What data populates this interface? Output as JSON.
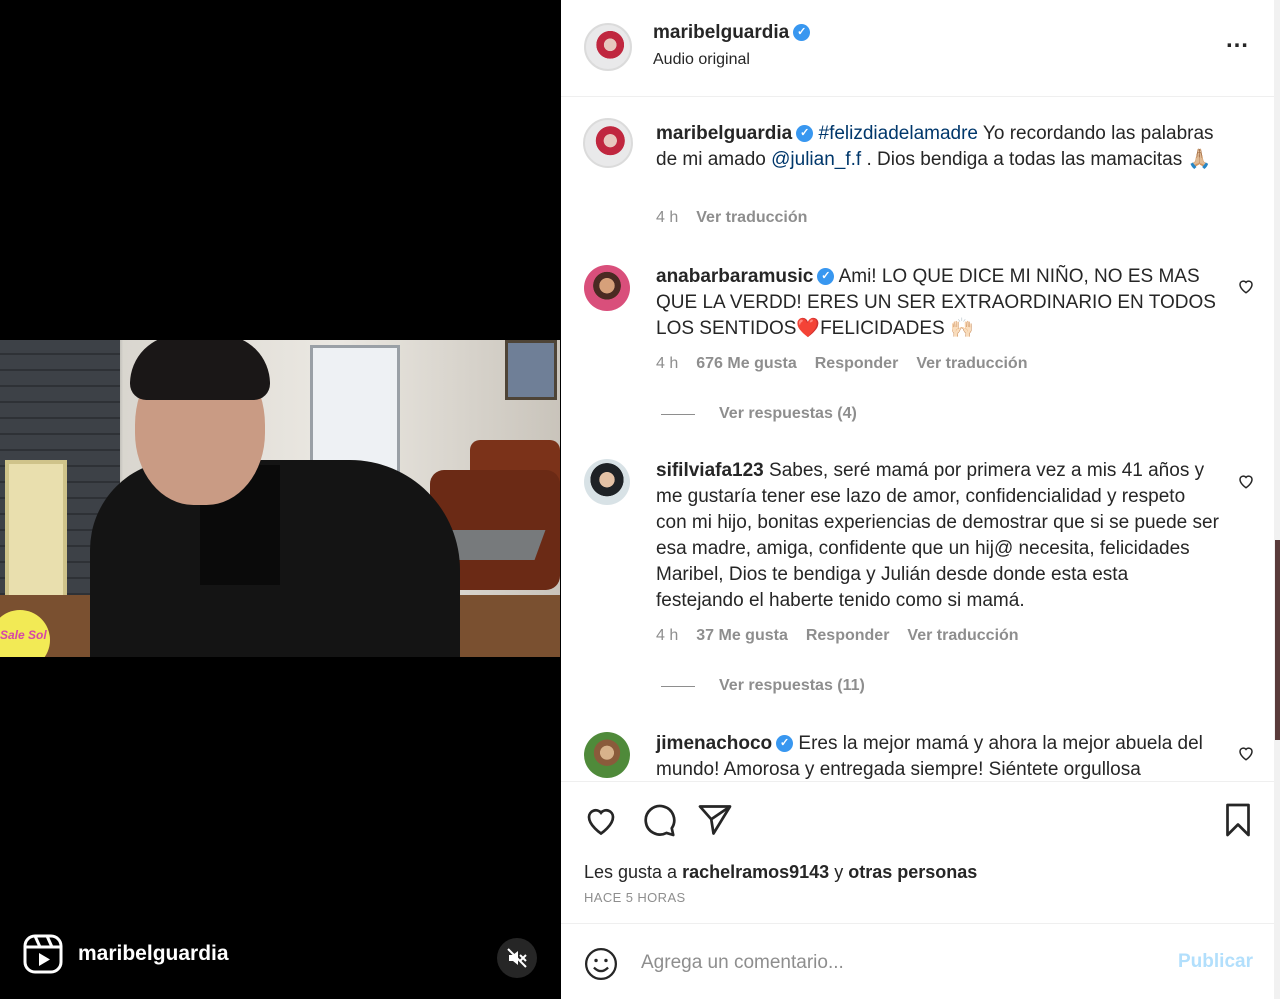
{
  "video": {
    "username": "maribelguardia",
    "badge_text": "Sale Sol",
    "reels_icon": "reels-icon",
    "mute_icon": "speaker-muted-icon"
  },
  "header": {
    "username": "maribelguardia",
    "verified_icon": "verified-badge-icon",
    "audio": "Audio original",
    "more_icon": "more-options-icon"
  },
  "caption": {
    "username": "maribelguardia",
    "hashtag": "#felizdiadelamadre",
    "text_1": " Yo recordando las palabras de mi amado ",
    "mention": "@julian_f.f",
    "text_2": " . Dios bendiga a todas las mamacitas 🙏🏼",
    "time": "4 h",
    "translate": "Ver traducción"
  },
  "comments": [
    {
      "username": "anabarbaramusic",
      "verified": true,
      "text": " Ami! LO QUE DICE MI NIÑO, NO ES MAS QUE LA VERDD! ERES UN SER EXTRAORDINARIO EN TODOS LOS SENTIDOS❤️FELICIDADES 🙌🏻",
      "time": "4 h",
      "likes": "676 Me gusta",
      "reply": "Responder",
      "translate": "Ver traducción",
      "replies": "Ver respuestas (4)"
    },
    {
      "username": "sifilviafa123",
      "verified": false,
      "text": " Sabes, seré mamá por primera vez a mis 41 años y me gustaría tener ese lazo de amor, confidencialidad y respeto con mi hijo, bonitas experiencias de demostrar que si se puede ser esa madre, amiga, confidente que un hij@ necesita, felicidades Maribel, Dios te bendiga y Julián desde donde esta esta festejando el haberte tenido como si mamá.",
      "time": "4 h",
      "likes": "37 Me gusta",
      "reply": "Responder",
      "translate": "Ver traducción",
      "replies": "Ver respuestas (11)"
    },
    {
      "username": "jimenachoco",
      "verified": true,
      "text": " Eres la mejor mamá y ahora la mejor abuela del mundo! Amorosa y entregada siempre! Siéntete orgullosa"
    }
  ],
  "actions": {
    "like_icon": "heart-icon",
    "comment_icon": "comment-icon",
    "share_icon": "paper-plane-icon",
    "save_icon": "bookmark-icon",
    "likes_prefix": "Les gusta a ",
    "likes_user": "rachelramos9143",
    "likes_mid": " y ",
    "likes_others": "otras personas",
    "time_ago": "HACE 5 HORAS"
  },
  "comment_box": {
    "emoji_icon": "emoji-icon",
    "placeholder": "Agrega un comentario...",
    "publish": "Publicar"
  },
  "colors": {
    "link": "#00376b",
    "verified": "#3897f0",
    "publish_disabled": "#b2dffc",
    "muted_text": "#8e8e8e"
  }
}
